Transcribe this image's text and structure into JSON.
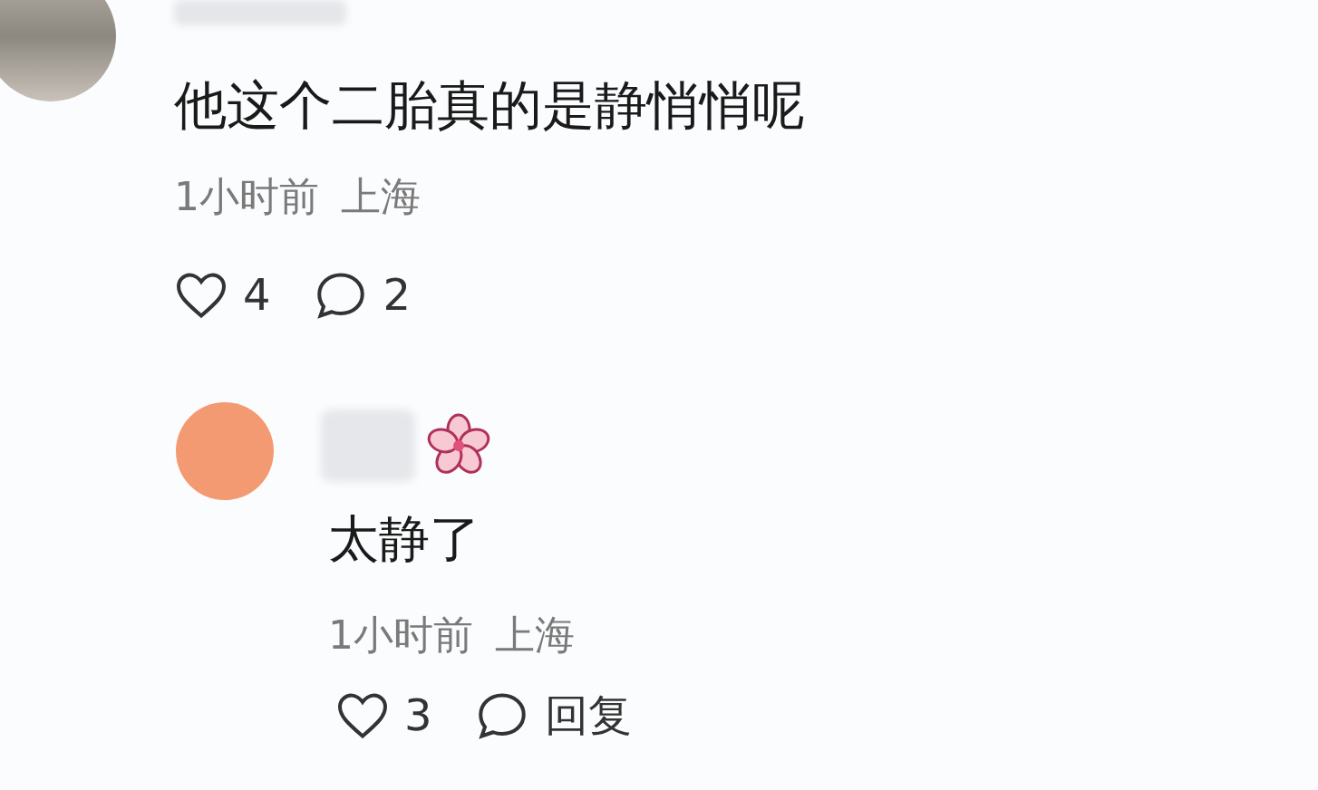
{
  "comment": {
    "text": "他这个二胎真的是静悄悄呢",
    "time": "1小时前",
    "location": "上海",
    "actions": [
      {
        "kind": "like",
        "label": "4"
      },
      {
        "kind": "comment",
        "label": "2"
      }
    ]
  },
  "reply": {
    "text": "太静了",
    "time": "1小时前",
    "location": "上海",
    "actions": [
      {
        "kind": "like",
        "label": "3"
      },
      {
        "kind": "comment",
        "label": "回复"
      }
    ]
  }
}
